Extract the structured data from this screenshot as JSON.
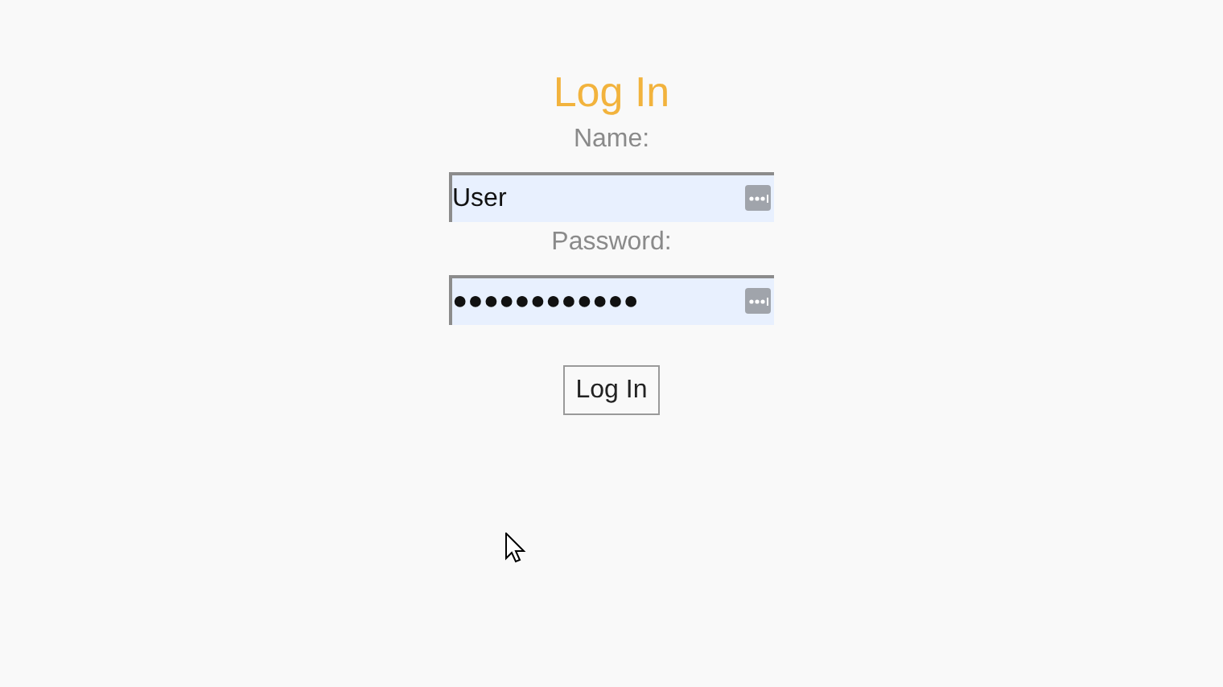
{
  "title": "Log In",
  "fields": [
    {
      "label": "Name:",
      "value": "User"
    },
    {
      "label": "Password:",
      "value": "●●●●●●●●●●●●"
    }
  ],
  "button": "Log In"
}
